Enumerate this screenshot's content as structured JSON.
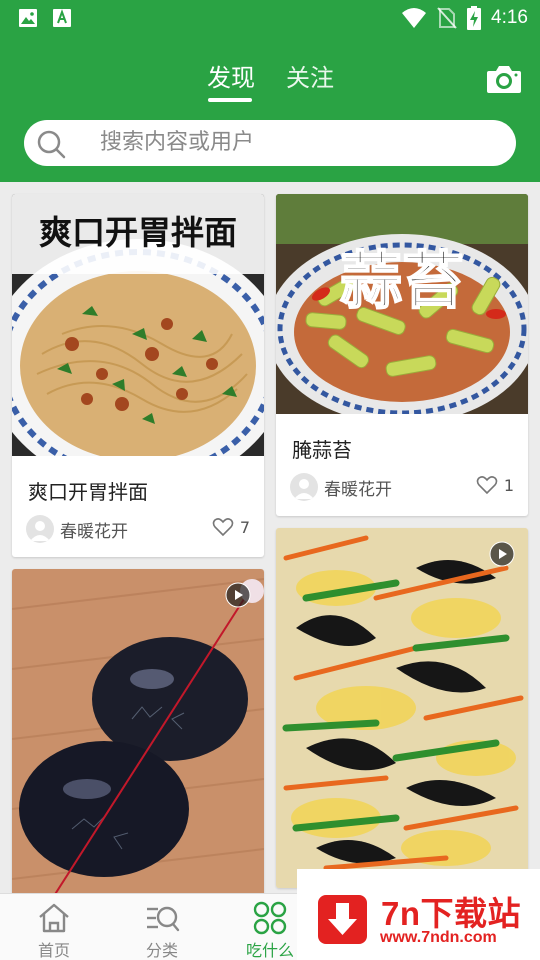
{
  "status_bar": {
    "time": "4:16",
    "left_icons": [
      "image-icon",
      "a-font-icon"
    ],
    "right_icons": [
      "wifi-icon",
      "no-sim-icon",
      "battery-charging-icon"
    ]
  },
  "header": {
    "tabs": [
      {
        "label": "发现",
        "active": true
      },
      {
        "label": "关注",
        "active": false
      }
    ],
    "camera_icon": "camera-icon",
    "search": {
      "placeholder": "搜索内容或用户",
      "icon": "search-icon"
    },
    "accent_color": "#2aa344"
  },
  "feed": {
    "cards": [
      {
        "column": "left",
        "image_caption": "爽口开胃拌面",
        "title": "爽口开胃拌面",
        "author": "春暖花开",
        "likes": "7",
        "video": false
      },
      {
        "column": "right",
        "image_caption": "蒜苔",
        "title": "腌蒜苔",
        "author": "春暖花开",
        "likes": "1",
        "video": false
      },
      {
        "column": "left",
        "title": "",
        "video": true
      },
      {
        "column": "right",
        "title": "",
        "video": true
      }
    ]
  },
  "bottom_nav": {
    "items": [
      {
        "label": "首页",
        "icon": "home-icon",
        "active": false
      },
      {
        "label": "分类",
        "icon": "category-search-icon",
        "active": false
      },
      {
        "label": "吃什么",
        "icon": "clover-icon",
        "active": true
      }
    ]
  },
  "watermark": {
    "name": "7n下载站",
    "url": "www.7ndn.com",
    "color": "#e32221"
  }
}
